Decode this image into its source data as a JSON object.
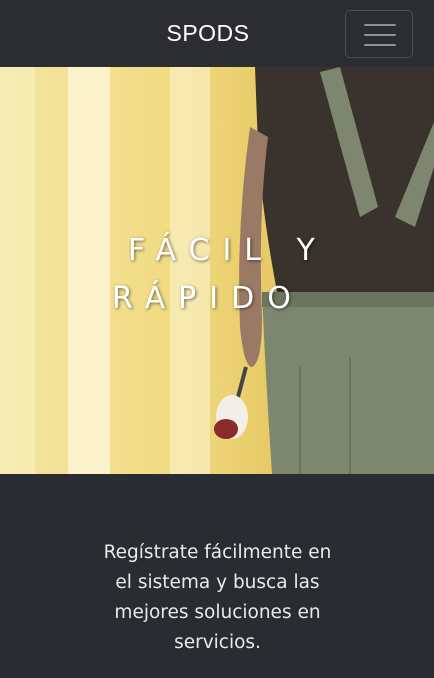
{
  "navbar": {
    "brand": "SPODS",
    "toggle_icon": "hamburger-menu-icon"
  },
  "hero": {
    "title_line1": "FÁCIL Y",
    "title_line2": "RÁPIDO"
  },
  "intro": {
    "text": "Regístrate fácilmente en el sistema y busca las mejores soluciones en servicios."
  },
  "colors": {
    "navbar_bg": "#2b2d31",
    "section_bg": "#292c31",
    "hero_yellow": "#f1db82"
  }
}
